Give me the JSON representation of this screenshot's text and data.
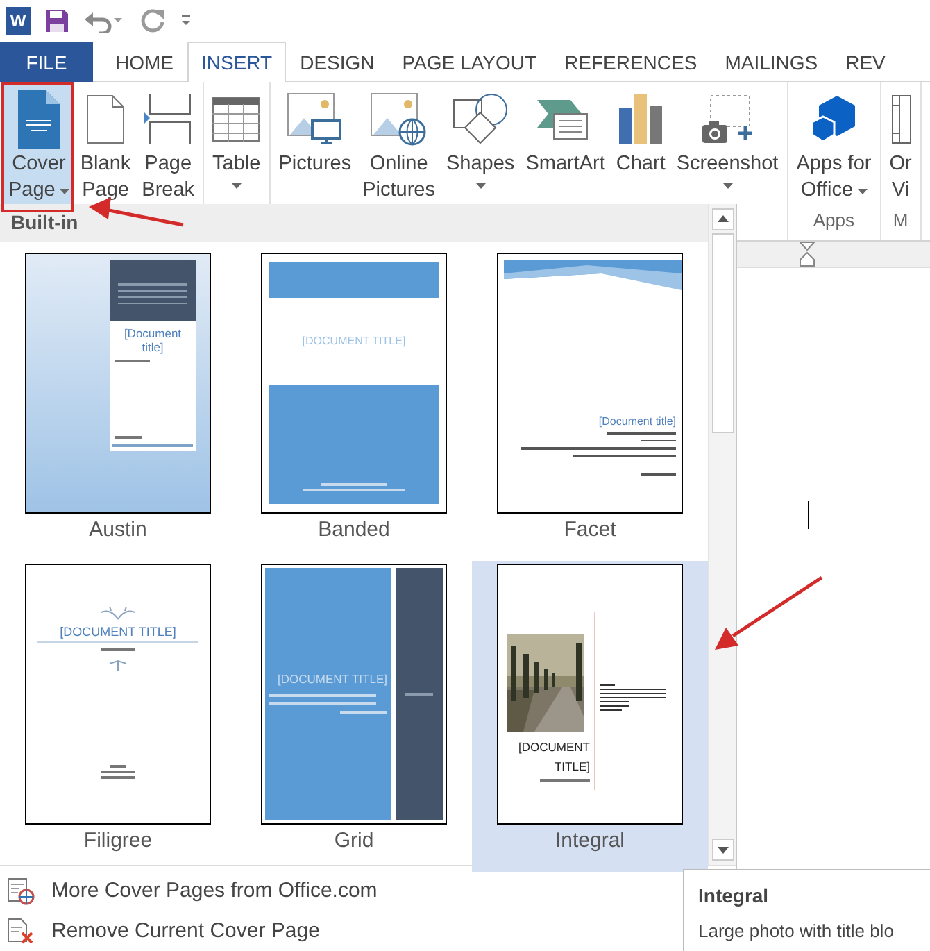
{
  "quick_access": {
    "logo": "W"
  },
  "tabs": [
    {
      "label": "FILE",
      "kind": "file",
      "selected": false
    },
    {
      "label": "HOME",
      "kind": "tab",
      "selected": false
    },
    {
      "label": "INSERT",
      "kind": "tab",
      "selected": true
    },
    {
      "label": "DESIGN",
      "kind": "tab",
      "selected": false
    },
    {
      "label": "PAGE LAYOUT",
      "kind": "tab",
      "selected": false
    },
    {
      "label": "REFERENCES",
      "kind": "tab",
      "selected": false
    },
    {
      "label": "MAILINGS",
      "kind": "tab",
      "selected": false
    },
    {
      "label": "REV",
      "kind": "tab",
      "selected": false
    }
  ],
  "ribbon": {
    "groups": [
      {
        "buttons": [
          {
            "kind": "cover",
            "lines": [
              "Cover",
              "Page"
            ],
            "dropdown": true,
            "selected": true
          },
          {
            "kind": "blank",
            "lines": [
              "Blank",
              "Page"
            ],
            "dropdown": false,
            "selected": false
          },
          {
            "kind": "break",
            "lines": [
              "Page",
              "Break"
            ],
            "dropdown": false,
            "selected": false
          }
        ]
      },
      {
        "buttons": [
          {
            "kind": "table",
            "lines": [
              "Table"
            ],
            "dropdown": true,
            "selected": false
          }
        ]
      },
      {
        "buttons": [
          {
            "kind": "pictures",
            "lines": [
              "Pictures"
            ],
            "dropdown": false,
            "selected": false
          },
          {
            "kind": "online",
            "lines": [
              "Online",
              "Pictures"
            ],
            "dropdown": false,
            "selected": false
          },
          {
            "kind": "shapes",
            "lines": [
              "Shapes"
            ],
            "dropdown": true,
            "selected": false
          },
          {
            "kind": "smartart",
            "lines": [
              "SmartArt"
            ],
            "dropdown": false,
            "selected": false
          },
          {
            "kind": "chart",
            "lines": [
              "Chart"
            ],
            "dropdown": false,
            "selected": false
          },
          {
            "kind": "screenshot",
            "lines": [
              "Screenshot"
            ],
            "dropdown": true,
            "selected": false
          }
        ]
      },
      {
        "label": "Apps",
        "buttons": [
          {
            "kind": "apps",
            "lines": [
              "Apps for",
              "Office"
            ],
            "dropdown": true,
            "selected": false
          }
        ]
      },
      {
        "label": "M",
        "buttons": [
          {
            "kind": "video",
            "lines": [
              "Or",
              "Vi"
            ],
            "dropdown": false,
            "selected": false
          }
        ]
      }
    ]
  },
  "gallery": {
    "header": "Built-in",
    "items": [
      {
        "name": "Austin",
        "kind": "austin",
        "title": "[Document title]",
        "selected": false
      },
      {
        "name": "Banded",
        "kind": "banded",
        "title": "[DOCUMENT TITLE]",
        "selected": false
      },
      {
        "name": "Facet",
        "kind": "facet",
        "title": "[Document title]",
        "selected": false
      },
      {
        "name": "Filigree",
        "kind": "filigree",
        "title": "[DOCUMENT TITLE]",
        "selected": false
      },
      {
        "name": "Grid",
        "kind": "grid",
        "title": "[DOCUMENT TITLE]",
        "selected": false
      },
      {
        "name": "Integral",
        "kind": "integral",
        "title": "[DOCUMENT TITLE]",
        "selected": true
      }
    ]
  },
  "menu": [
    {
      "kind": "more",
      "label": "More Cover Pages from Office.com"
    },
    {
      "kind": "remove",
      "label": "Remove Current Cover Page"
    }
  ],
  "tooltip": {
    "title": "Integral",
    "description": "Large photo with title blo"
  }
}
